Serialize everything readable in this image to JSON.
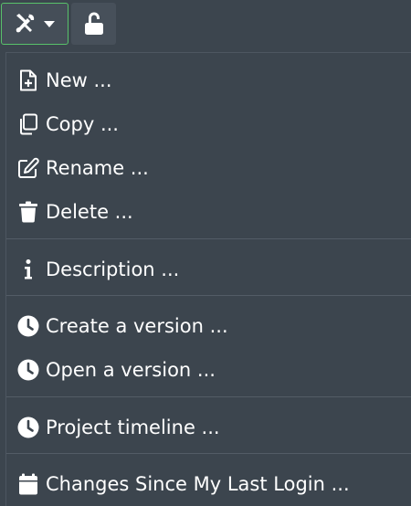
{
  "toolbar": {
    "tools_icon": "tools-icon",
    "dropdown_icon": "caret-down-icon",
    "lock_icon": "unlocked-padlock-icon",
    "accent_color": "#58c16a"
  },
  "menu": {
    "items": [
      {
        "label": "New ...",
        "icon": "file-plus-icon"
      },
      {
        "label": "Copy ...",
        "icon": "copy-icon"
      },
      {
        "label": "Rename ...",
        "icon": "edit-icon"
      },
      {
        "label": "Delete ...",
        "icon": "trash-icon"
      },
      {
        "label": "Description ...",
        "icon": "info-icon"
      },
      {
        "label": "Create a version ...",
        "icon": "clock-icon"
      },
      {
        "label": "Open a version ...",
        "icon": "clock-icon"
      },
      {
        "label": "Project timeline ...",
        "icon": "clock-icon"
      },
      {
        "label": "Changes Since My Last Login ...",
        "icon": "calendar-icon"
      }
    ]
  }
}
